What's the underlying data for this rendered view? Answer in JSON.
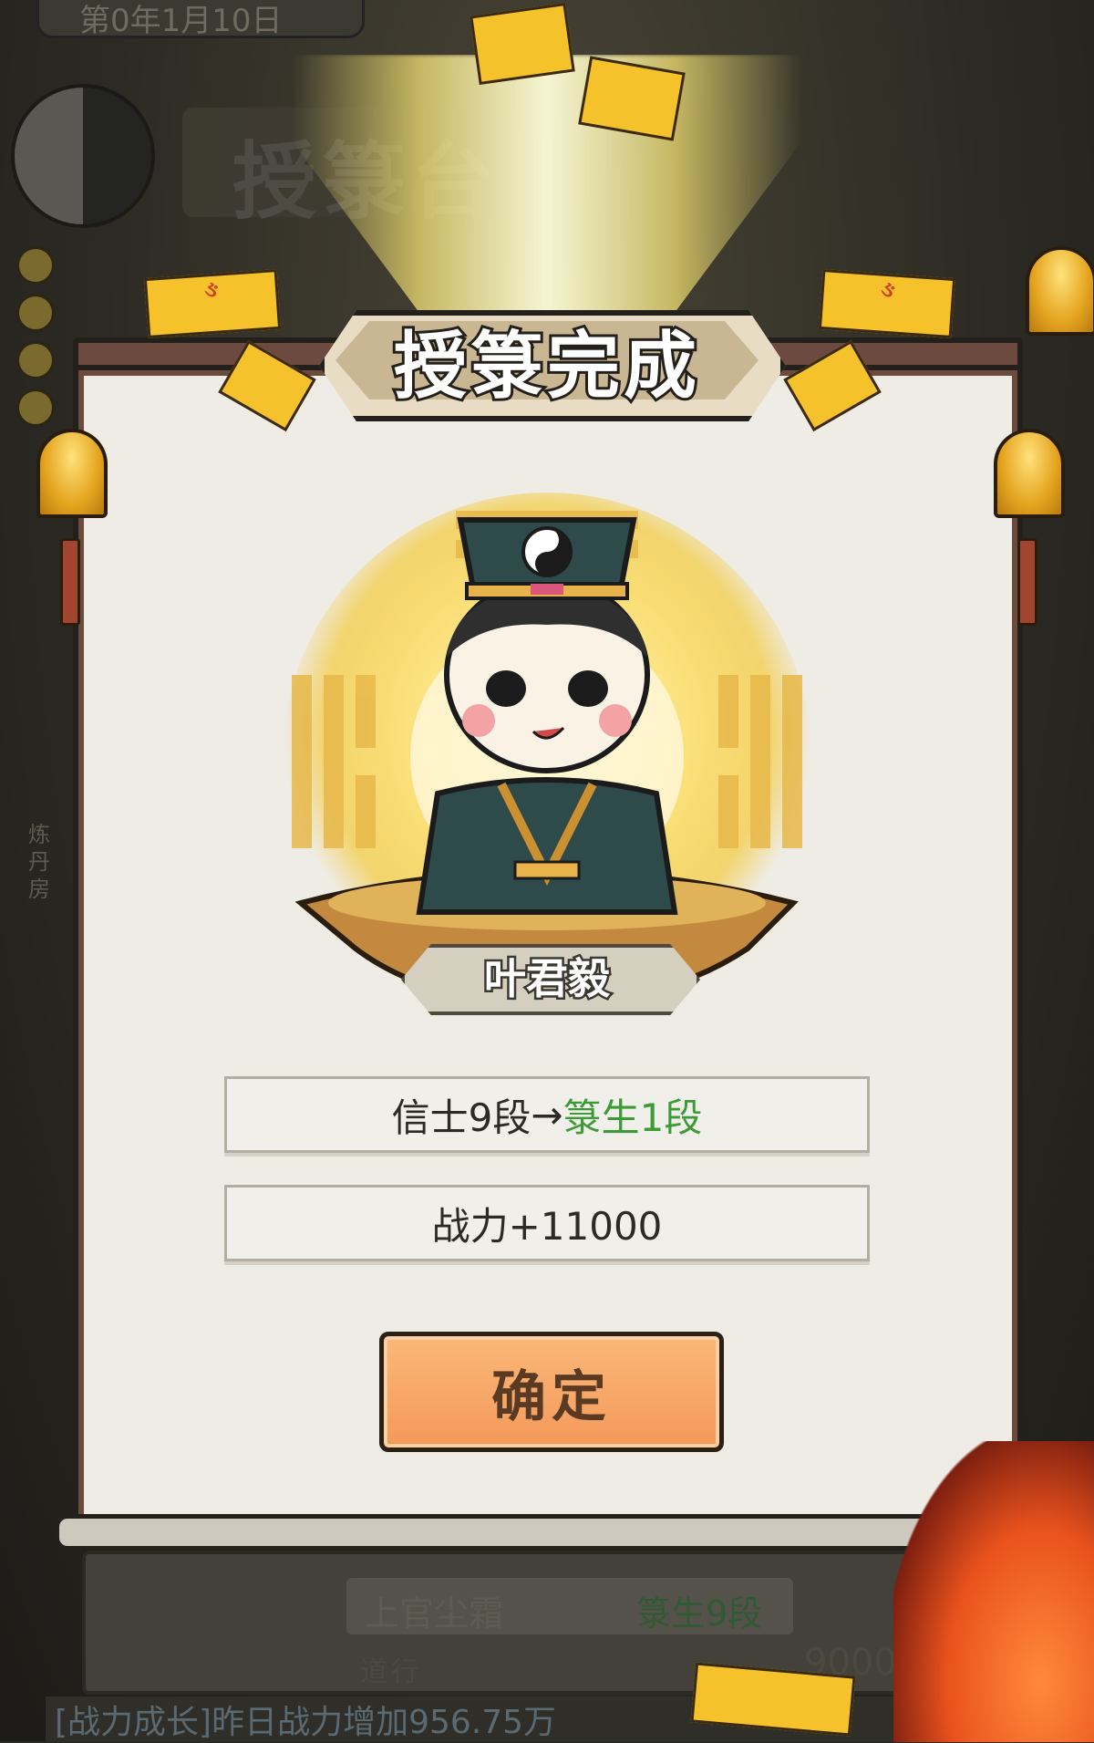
{
  "background": {
    "date": "第0年1月10日",
    "title": "授箓台",
    "side_label": "炼丹房",
    "bottom_card": {
      "name": "上官尘霜",
      "rank": "箓生9段",
      "number": "9000",
      "misc": "道行"
    },
    "ticker": "[战力成长]昨日战力增加956.75万"
  },
  "modal": {
    "title": "授箓完成",
    "character_name": "叶君毅",
    "rank_from": "信士9段",
    "arrow": "→",
    "rank_to": "箓生1段",
    "power_change": "战力+11000",
    "confirm_label": "确定"
  },
  "colors": {
    "rank_new": "#3c9a37",
    "confirm_button": "#f3995a",
    "modal_border": "#6b4b3e",
    "talisman": "#f6c22b"
  }
}
